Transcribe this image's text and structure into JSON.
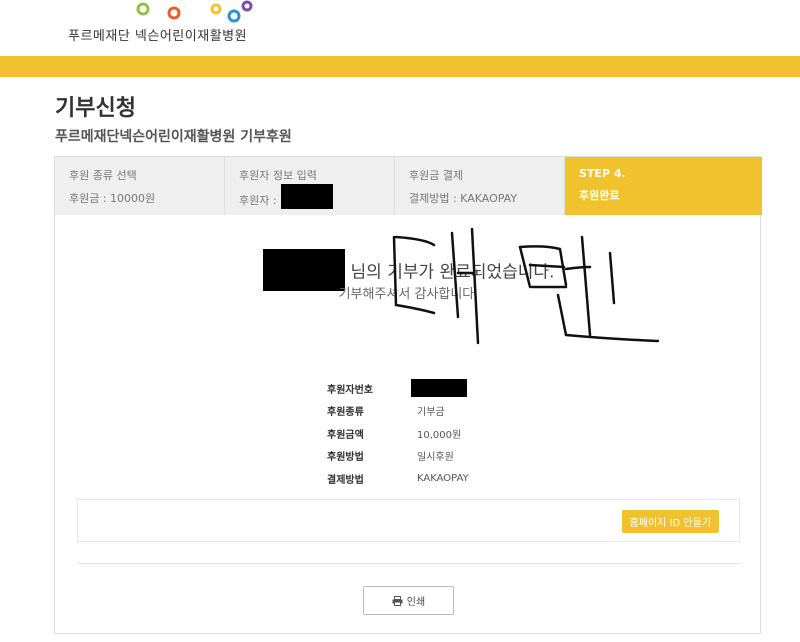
{
  "header": {
    "org_name": "푸르메재단 넥슨어린이재활병원",
    "logo_colors": [
      "#f0c22e",
      "#8bc34a",
      "#e85d2f",
      "#f0c22e",
      "#2f8fd6",
      "#7b4fa8"
    ]
  },
  "page": {
    "title": "기부신청",
    "subtitle": "푸르메재단넥슨어린이재활병원 기부후원"
  },
  "steps": [
    {
      "title": "후원 종류 선택",
      "detail": "후원금 : 10000원",
      "active": false
    },
    {
      "title": "후원자 정보 입력",
      "detail": "후원자 :",
      "active": false
    },
    {
      "title": "후원금 결제",
      "detail": "결제방법 : KAKAOPAY",
      "active": false
    },
    {
      "title": "STEP 4.",
      "detail": "후원완료",
      "active": true
    }
  ],
  "complete": {
    "message": "님의 기부가 완료되었습니다.",
    "thanks": "기부해주셔서 감사합니다."
  },
  "info": [
    {
      "label": "후원자번호",
      "value": ""
    },
    {
      "label": "후원종류",
      "value": "기부금"
    },
    {
      "label": "후원금액",
      "value": "10,000원"
    },
    {
      "label": "후원방법",
      "value": "일시후원"
    },
    {
      "label": "결제방법",
      "value": "KAKAOPAY"
    }
  ],
  "buttons": {
    "homepage_id": "홈페이지 ID 만들기",
    "print": "인쇄"
  },
  "colors": {
    "accent": "#f0c22e"
  },
  "icons": {
    "print": "printer-icon"
  }
}
